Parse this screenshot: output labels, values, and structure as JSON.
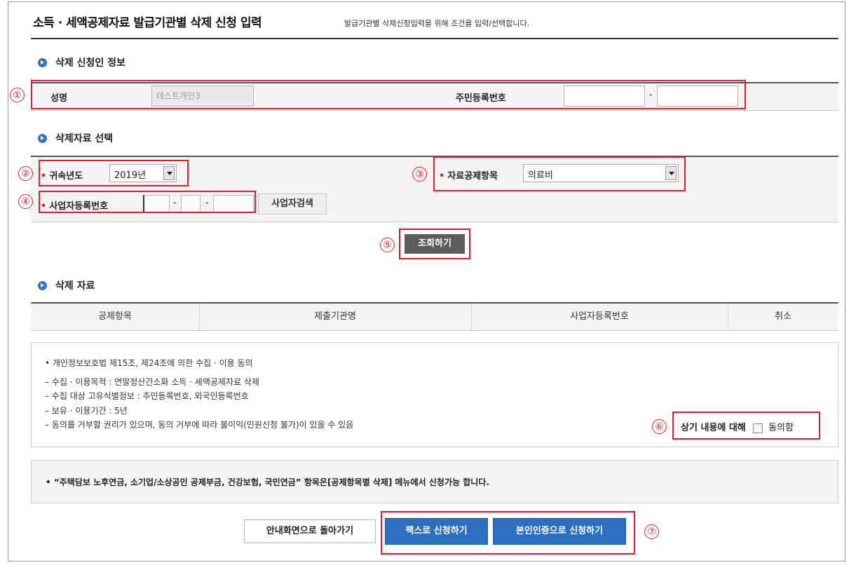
{
  "header": {
    "title": "소득 · 세액공제자료  발급기관별 삭제 신청 입력",
    "subtitle": "발급기관별 삭제신청입력을 위해 조건을 입력/선택합니다."
  },
  "markers": [
    "①",
    "②",
    "③",
    "④",
    "⑤",
    "⑥",
    "⑦"
  ],
  "applicant": {
    "heading": "삭제 신청인 정보",
    "name_label": "성명",
    "name_value": "테스트개인3",
    "rrn_label": "주민등록번호",
    "rrn_front": "",
    "rrn_sep": "-",
    "rrn_back": ""
  },
  "selection": {
    "heading": "삭제자료 선택",
    "required_mark": "•",
    "year_label": "귀속년도",
    "year_value": "2019년",
    "item_label": "자료공제항목",
    "item_value": "의료비",
    "bizno_label": "사업자등록번호",
    "bizno_sep": "-",
    "bizno_search": "사업자검색",
    "query_button": "조회하기"
  },
  "result": {
    "heading": "삭제 자료",
    "columns": [
      "공제항목",
      "제출기관명",
      "사업자등록번호",
      "취소"
    ]
  },
  "consent": {
    "lines": [
      "• 개인정보보호법 제15조, 제24조에 의한 수집 · 이용 동의",
      "– 수집 · 이용목적 : 연말정산간소화 소득 · 세액공제자료 삭제",
      "– 수집 대상 고유식별정보 : 주민등록번호, 외국인등록번호",
      "– 보유 · 이용기간 : 5년",
      "– 동의를 거부할 권리가 있으며, 동의 거부에 따라 불이익(민원신청 불가)이 있을 수 있음"
    ],
    "agree_prompt": "상기 내용에 대해",
    "agree_label": "동의함",
    "agree_checked": false
  },
  "notice": "• “주택담보 노후연금, 소기업/소상공인 공제부금, 건강보험, 국민연금” 항목은[공제항목별 삭제] 메뉴에서 신청가능 합니다.",
  "footer": {
    "back_button": "안내화면으로 돌아가기",
    "fax_button": "팩스로 신청하기",
    "auth_button": "본인인증으로 신청하기"
  },
  "colors": {
    "accent_blue": "#2c6fc0",
    "highlight_red": "#e2202a",
    "dark_button": "#5c5c5c"
  }
}
